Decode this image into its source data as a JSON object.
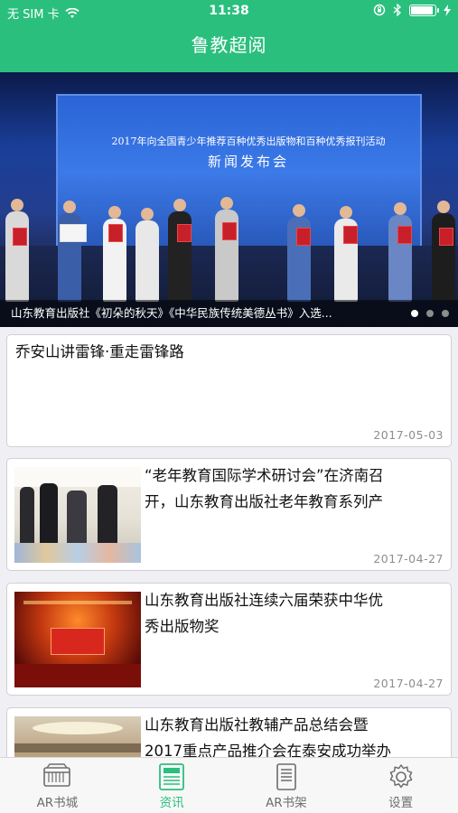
{
  "status_bar": {
    "carrier": "无 SIM 卡",
    "time": "11:38"
  },
  "nav": {
    "title": "鲁教超阅"
  },
  "banner": {
    "stage_heading": "2017年向全国青少年推荐百种优秀出版物和百种优秀报刊活动",
    "stage_subheading": "新闻发布会",
    "caption": "山东教育出版社《初朵的秋天》《中华民族传统美德丛书》入选...",
    "page_count": 3,
    "active_page": 1
  },
  "news": [
    {
      "title": "乔安山讲雷锋·重走雷锋路",
      "date": "2017-05-03",
      "has_image": false
    },
    {
      "title_line1": "“老年教育国际学术研讨会”在济南召",
      "title_line2": "开，山东教育出版社老年教育系列产",
      "date": "2017-04-27",
      "has_image": true,
      "image": "conference-photo"
    },
    {
      "title_line1": "山东教育出版社连续六届荣获中华优",
      "title_line2": "秀出版物奖",
      "date": "2017-04-27",
      "has_image": true,
      "image": "award-ceremony-photo"
    },
    {
      "title_line1": "山东教育出版社教辅产品总结会暨",
      "title_line2": "2017重点产品推介会在泰安成功举办",
      "has_image": true,
      "image": "meeting-hall-photo"
    }
  ],
  "tabs": [
    {
      "label": "AR书城",
      "icon": "bookstore-icon",
      "active": false
    },
    {
      "label": "资讯",
      "icon": "news-icon",
      "active": true
    },
    {
      "label": "AR书架",
      "icon": "bookshelf-icon",
      "active": false
    },
    {
      "label": "设置",
      "icon": "settings-gear-icon",
      "active": false
    }
  ],
  "colors": {
    "brand": "#2bbf7e",
    "tab_inactive": "#6d6d6d",
    "date_text": "#8d8d8d"
  }
}
